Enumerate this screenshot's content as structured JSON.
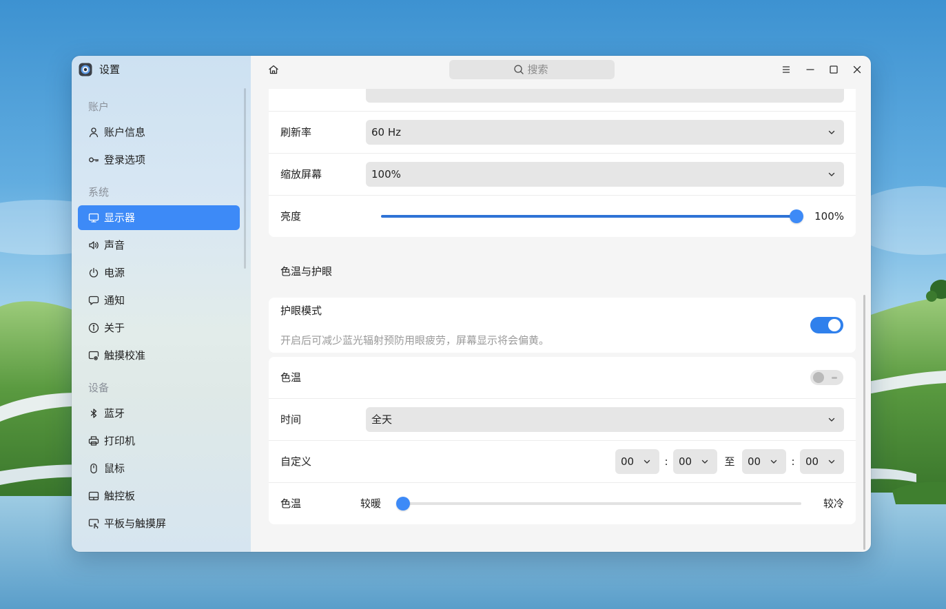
{
  "window": {
    "title": "设置",
    "app_icon": "settings-app-icon"
  },
  "header": {
    "home_icon": "home-icon",
    "search": {
      "placeholder": "搜索",
      "icon": "search-icon"
    },
    "controls": [
      "menu-icon",
      "minimize-icon",
      "maximize-icon",
      "close-icon"
    ]
  },
  "sidebar": {
    "groups": [
      {
        "label": "账户",
        "items": [
          {
            "label": "账户信息",
            "icon": "person-icon"
          },
          {
            "label": "登录选项",
            "icon": "key-icon"
          }
        ]
      },
      {
        "label": "系统",
        "items": [
          {
            "label": "显示器",
            "icon": "monitor-icon",
            "selected": true
          },
          {
            "label": "声音",
            "icon": "speaker-icon"
          },
          {
            "label": "电源",
            "icon": "power-icon"
          },
          {
            "label": "通知",
            "icon": "notification-icon"
          },
          {
            "label": "关于",
            "icon": "info-icon"
          },
          {
            "label": "触摸校准",
            "icon": "touch-calibration-icon"
          }
        ]
      },
      {
        "label": "设备",
        "items": [
          {
            "label": "蓝牙",
            "icon": "bluetooth-icon"
          },
          {
            "label": "打印机",
            "icon": "printer-icon"
          },
          {
            "label": "鼠标",
            "icon": "mouse-icon"
          },
          {
            "label": "触控板",
            "icon": "touchpad-icon"
          },
          {
            "label": "平板与触摸屏",
            "icon": "tablet-icon"
          }
        ]
      }
    ]
  },
  "display": {
    "refresh_rate": {
      "label": "刷新率",
      "value": "60 Hz"
    },
    "scale": {
      "label": "缩放屏幕",
      "value": "100%"
    },
    "brightness": {
      "label": "亮度",
      "level": 1.0,
      "value_label": "100%"
    }
  },
  "eye_care": {
    "section_title": "色温与护眼",
    "eye_mode": {
      "label": "护眼模式",
      "description": "开启后可减少蓝光辐射预防用眼疲劳，屏幕显示将会偏黄。",
      "enabled": true
    },
    "color_temp_switch": {
      "label": "色温",
      "enabled": false
    },
    "time": {
      "label": "时间",
      "value": "全天"
    },
    "custom": {
      "label": "自定义",
      "start_hour": "00",
      "start_minute": "00",
      "end_hour": "00",
      "end_minute": "00",
      "time_separator": ":",
      "range_separator": "至"
    },
    "color_temperature": {
      "label": "色温",
      "warm_label": "较暖",
      "cool_label": "较冷",
      "level": 0.0
    }
  },
  "colors": {
    "accent": "#3d8af7",
    "toggle_on": "#2f80ec",
    "slider_fill": "#2f73d6"
  }
}
